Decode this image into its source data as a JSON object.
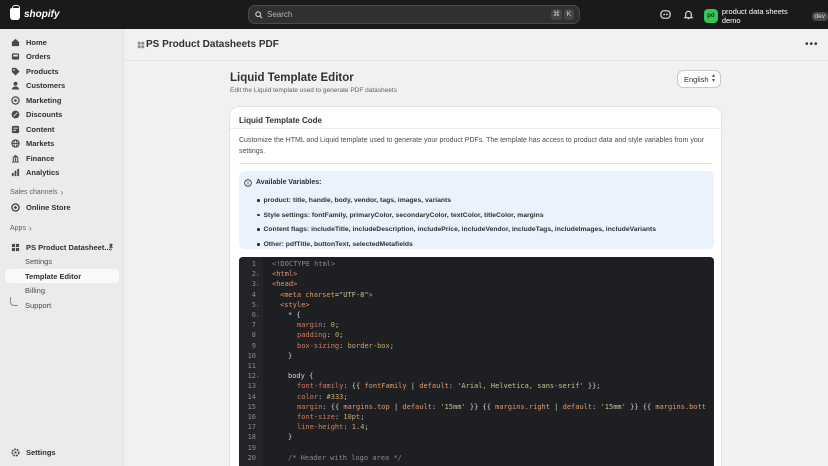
{
  "topbar": {
    "brand": "shopify",
    "search_placeholder": "Search",
    "shortcut_keys": [
      "⌘",
      "K"
    ],
    "store_initials": "pd",
    "store_name": "product data sheets demo",
    "store_badge": "dev"
  },
  "sidebar": {
    "nav": [
      {
        "label": "Home",
        "icon": "home-icon"
      },
      {
        "label": "Orders",
        "icon": "orders-icon"
      },
      {
        "label": "Products",
        "icon": "tag-icon"
      },
      {
        "label": "Customers",
        "icon": "person-icon"
      },
      {
        "label": "Marketing",
        "icon": "target-icon"
      },
      {
        "label": "Discounts",
        "icon": "discount-icon"
      },
      {
        "label": "Content",
        "icon": "content-icon"
      },
      {
        "label": "Markets",
        "icon": "globe-icon"
      },
      {
        "label": "Finance",
        "icon": "finance-icon"
      },
      {
        "label": "Analytics",
        "icon": "chart-icon"
      }
    ],
    "sales_channels_label": "Sales channels",
    "online_store_label": "Online Store",
    "apps_label": "Apps",
    "app_name": "PS Product Datasheet...",
    "app_subitems": [
      "Settings",
      "Template Editor",
      "Billing",
      "Support"
    ],
    "settings_label": "Settings"
  },
  "page": {
    "header_title": "PS Product Datasheets PDF",
    "editor_title": "Liquid Template Editor",
    "editor_subtitle": "Edit the Liquid template used to generate PDF datasheets",
    "language": "English"
  },
  "card": {
    "title": "Liquid Template Code",
    "description": "Customize the HTML and Liquid template used to generate your product PDFs. The template has access to product data and style variables from your settings.",
    "info_title": "Available Variables:",
    "variables": [
      "product: title, handle, body, vendor, tags, images, variants",
      "Style settings: fontFamily, primaryColor, secondaryColor, textColor, titleColor, margins",
      "Content flags: includeTitle, includeDescription, includePrice, includeVendor, includeTags, includeImages, includeVariants",
      "Other: pdfTitle, buttonText, selectedMetafields"
    ]
  },
  "code": {
    "line_numbers": [
      "1",
      "2",
      "3",
      "4",
      "5",
      "6",
      "7",
      "8",
      "9",
      "10",
      "11",
      "12",
      "13",
      "14",
      "15",
      "16",
      "17",
      "18",
      "19",
      "20"
    ],
    "l1": "<!DOCTYPE html>",
    "l2": "<html>",
    "l3": "<head>",
    "l4a": "<meta ",
    "l4b": "charset",
    "l4c": "=",
    "l4d": "\"UTF-8\"",
    "l4e": ">",
    "l5": "<style>",
    "l6": "* {",
    "l7a": "margin",
    "l7b": ": ",
    "l7c": "0",
    "l7d": ";",
    "l8a": "padding",
    "l8b": ": ",
    "l8c": "0",
    "l8d": ";",
    "l9a": "box-sizing",
    "l9b": ": ",
    "l9c": "border-box",
    "l9d": ";",
    "l10": "}",
    "l12": "body {",
    "l13a": "font-family",
    "l13b": ": {{ ",
    "l13c": "fontFamily",
    "l13d": " | ",
    "l13e": "default",
    "l13f": ": ",
    "l13g": "'Arial, Helvetica, sans-serif'",
    "l13h": " }};",
    "l14a": "color",
    "l14b": ": ",
    "l14c": "#333",
    "l14d": ";",
    "l15a": "margin",
    "l15b": ": {{ ",
    "l15c": "margins.top",
    "l15d": " | ",
    "l15e": "default",
    "l15f": ": ",
    "l15g": "'15mm'",
    "l15h": " }} {{ ",
    "l15i": "margins.right",
    "l15j": " | ",
    "l15k": "default",
    "l15l": ": ",
    "l15m": "'15mm'",
    "l15n": " }} {{ ",
    "l15o": "margins.bott",
    "l16a": "font-size",
    "l16b": ": ",
    "l16c": "10pt",
    "l16d": ";",
    "l17a": "line-height",
    "l17b": ": ",
    "l17c": "1.4",
    "l17d": ";",
    "l18": "}",
    "l20": "/* Header with logo area */"
  }
}
